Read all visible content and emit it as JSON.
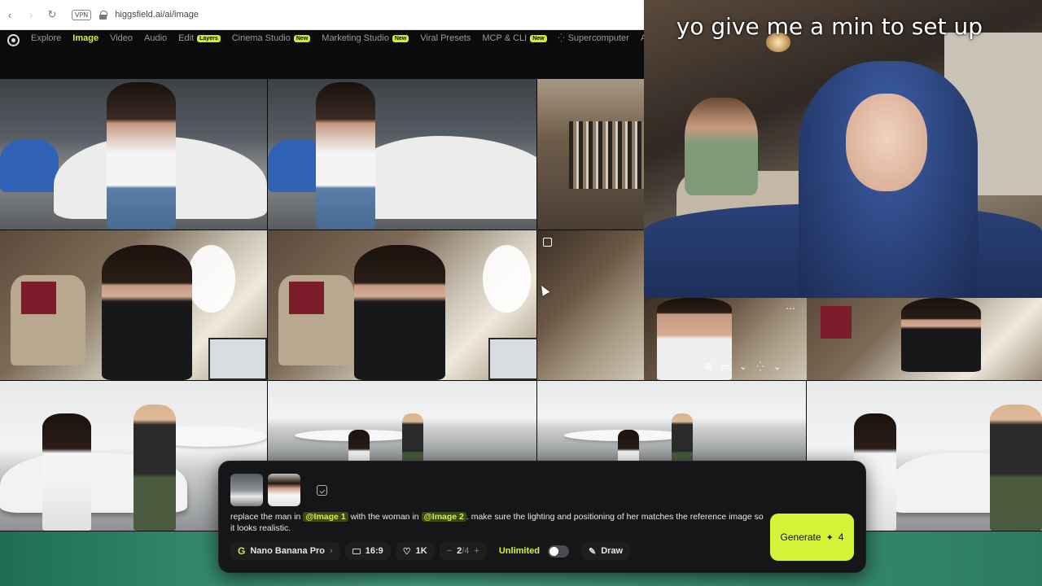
{
  "browser": {
    "back_icon": "‹",
    "forward_icon": "›",
    "reload_icon": "↻",
    "vpn_label": "VPN",
    "url": "higgsfield.ai/ai/image"
  },
  "nav": {
    "items": [
      {
        "label": "Explore",
        "badge": ""
      },
      {
        "label": "Image",
        "badge": "",
        "active": true
      },
      {
        "label": "Video",
        "badge": ""
      },
      {
        "label": "Audio",
        "badge": ""
      },
      {
        "label": "Edit",
        "badge": "Layers"
      },
      {
        "label": "Cinema Studio",
        "badge": "New"
      },
      {
        "label": "Marketing Studio",
        "badge": "New"
      },
      {
        "label": "Viral Presets",
        "badge": ""
      },
      {
        "label": "MCP & CLI",
        "badge": "New"
      },
      {
        "label": "Supercomputer",
        "badge": ""
      },
      {
        "label": "Ac",
        "badge": ""
      }
    ],
    "accent": "#d6f33a"
  },
  "stream": {
    "caption": "yo give me a min to set up",
    "more_icon": "⋯"
  },
  "tile_tools": {
    "icons": [
      "⧉",
      "▭",
      "⌄",
      "⁛",
      "⌄"
    ]
  },
  "prompt_panel": {
    "prompt_parts": [
      {
        "text": "replace the man in ",
        "mention": false
      },
      {
        "text": "@Image 1",
        "mention": true
      },
      {
        "text": " with the woman in ",
        "mention": false
      },
      {
        "text": "@Image 2",
        "mention": true
      },
      {
        "text": ". make sure the lighting and positioning of her matches the reference image so it looks realistic.",
        "mention": false
      }
    ],
    "model_icon": "G",
    "model": "Nano Banana Pro",
    "model_chevron": "›",
    "aspect": "16:9",
    "resolution": "1K",
    "count_minus": "−",
    "count_current": "2",
    "count_total": "/4",
    "count_plus": "+",
    "unlimited_label": "Unlimited",
    "draw_label": "Draw",
    "generate_label": "Generate",
    "generate_cost": "4",
    "spark_icon": "✦",
    "heart_icon": "♡",
    "pen_icon": "✎"
  }
}
